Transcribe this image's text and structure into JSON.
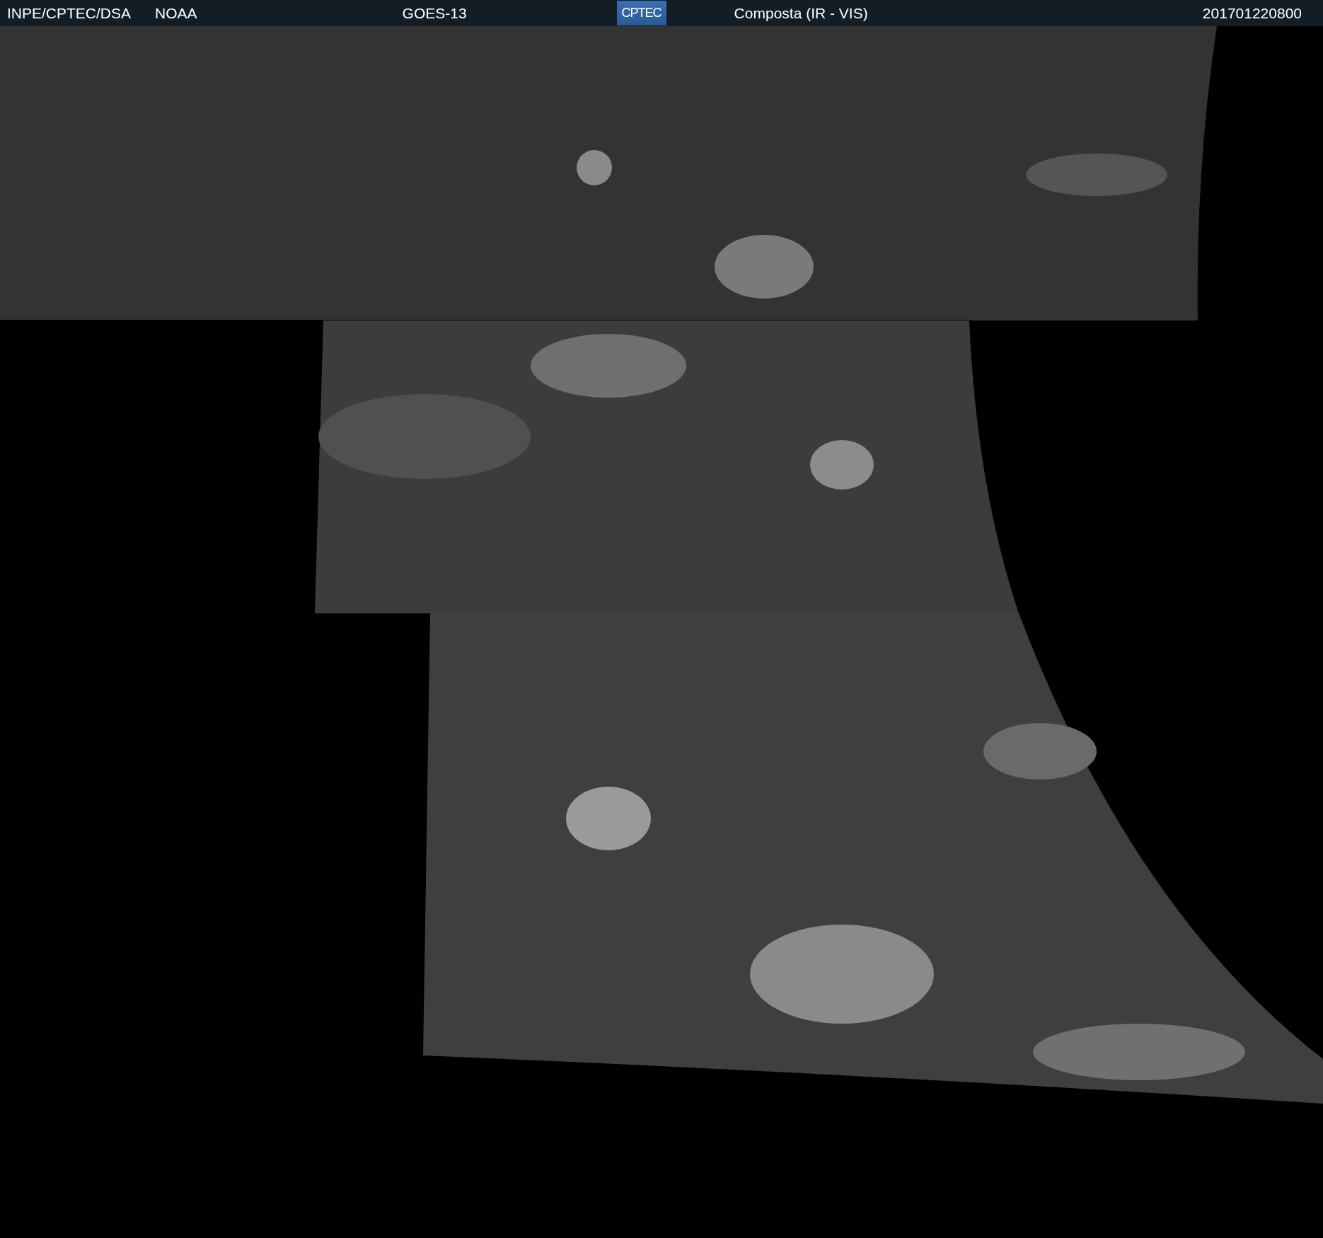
{
  "header": {
    "items": [
      {
        "kind": "text",
        "text": "INPE/CPTEC/DSA"
      },
      {
        "kind": "text",
        "text": "NOAA"
      },
      {
        "kind": "text",
        "text": "GOES-13"
      },
      {
        "kind": "logo",
        "text": "CPTEC"
      },
      {
        "kind": "text",
        "text": "Composta (IR - VIS)"
      },
      {
        "kind": "text",
        "text": "201701220800"
      }
    ]
  }
}
